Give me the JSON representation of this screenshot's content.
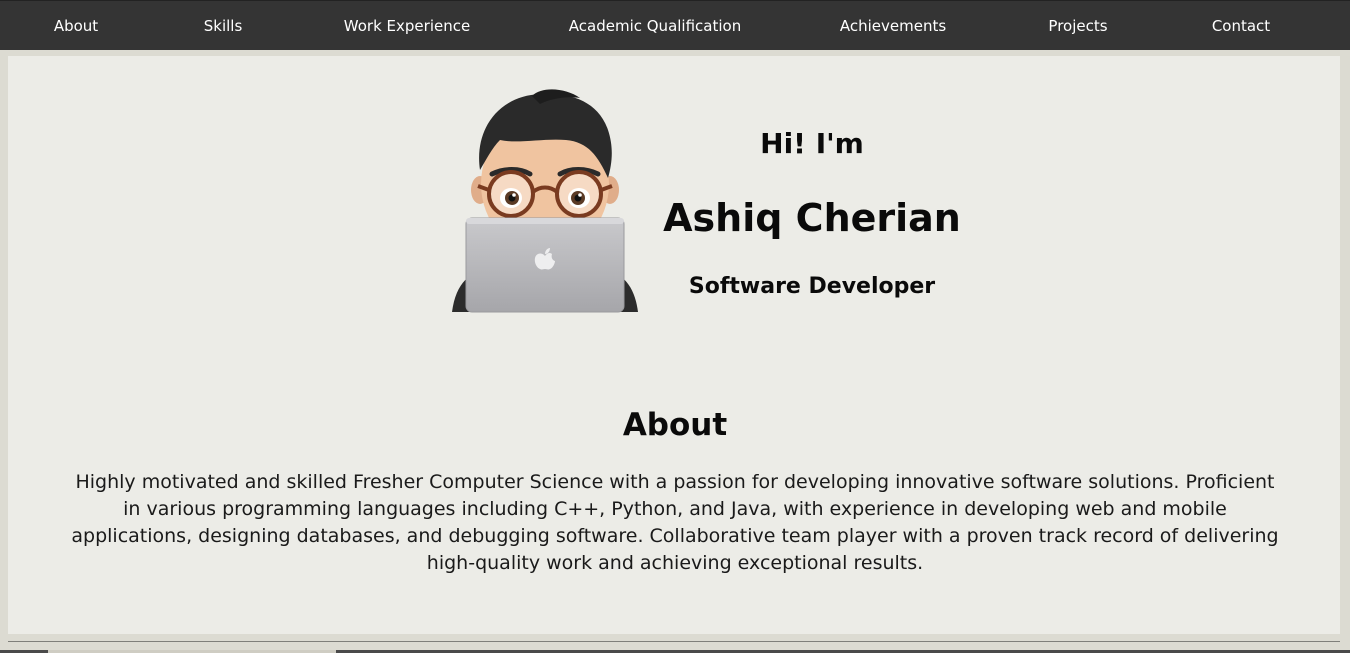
{
  "nav": {
    "items": [
      {
        "label": "About"
      },
      {
        "label": "Skills"
      },
      {
        "label": "Work Experience"
      },
      {
        "label": "Academic Qualification"
      },
      {
        "label": "Achievements"
      },
      {
        "label": "Projects"
      },
      {
        "label": "Contact"
      }
    ]
  },
  "hero": {
    "greeting": "Hi! I'm",
    "name": "Ashiq Cherian",
    "role": "Software Developer",
    "avatar_icon": "memoji-with-laptop-icon"
  },
  "about": {
    "title": "About",
    "text": "Highly motivated and skilled Fresher Computer Science with a passion for developing innovative software solutions. Proficient in various programming languages including C++, Python, and Java, with experience in developing web and mobile applications, designing databases, and debugging software. Collaborative team player with a proven track record of delivering high-quality work and achieving exceptional results."
  },
  "colors": {
    "navbar": "#343434",
    "page_background": "#dcdbd2",
    "panel": "#ecece7",
    "nav_text": "#ffffff"
  }
}
